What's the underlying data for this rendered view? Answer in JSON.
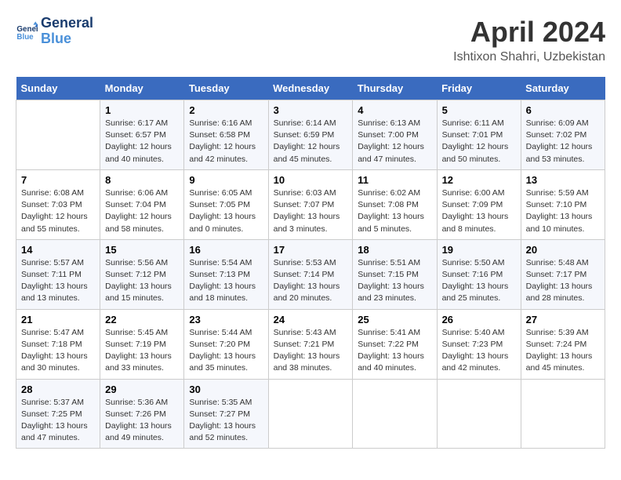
{
  "header": {
    "logo_line1": "General",
    "logo_line2": "Blue",
    "title": "April 2024",
    "subtitle": "Ishtixon Shahri, Uzbekistan"
  },
  "calendar": {
    "days_of_week": [
      "Sunday",
      "Monday",
      "Tuesday",
      "Wednesday",
      "Thursday",
      "Friday",
      "Saturday"
    ],
    "weeks": [
      [
        {
          "day": "",
          "info": ""
        },
        {
          "day": "1",
          "info": "Sunrise: 6:17 AM\nSunset: 6:57 PM\nDaylight: 12 hours\nand 40 minutes."
        },
        {
          "day": "2",
          "info": "Sunrise: 6:16 AM\nSunset: 6:58 PM\nDaylight: 12 hours\nand 42 minutes."
        },
        {
          "day": "3",
          "info": "Sunrise: 6:14 AM\nSunset: 6:59 PM\nDaylight: 12 hours\nand 45 minutes."
        },
        {
          "day": "4",
          "info": "Sunrise: 6:13 AM\nSunset: 7:00 PM\nDaylight: 12 hours\nand 47 minutes."
        },
        {
          "day": "5",
          "info": "Sunrise: 6:11 AM\nSunset: 7:01 PM\nDaylight: 12 hours\nand 50 minutes."
        },
        {
          "day": "6",
          "info": "Sunrise: 6:09 AM\nSunset: 7:02 PM\nDaylight: 12 hours\nand 53 minutes."
        }
      ],
      [
        {
          "day": "7",
          "info": "Sunrise: 6:08 AM\nSunset: 7:03 PM\nDaylight: 12 hours\nand 55 minutes."
        },
        {
          "day": "8",
          "info": "Sunrise: 6:06 AM\nSunset: 7:04 PM\nDaylight: 12 hours\nand 58 minutes."
        },
        {
          "day": "9",
          "info": "Sunrise: 6:05 AM\nSunset: 7:05 PM\nDaylight: 13 hours\nand 0 minutes."
        },
        {
          "day": "10",
          "info": "Sunrise: 6:03 AM\nSunset: 7:07 PM\nDaylight: 13 hours\nand 3 minutes."
        },
        {
          "day": "11",
          "info": "Sunrise: 6:02 AM\nSunset: 7:08 PM\nDaylight: 13 hours\nand 5 minutes."
        },
        {
          "day": "12",
          "info": "Sunrise: 6:00 AM\nSunset: 7:09 PM\nDaylight: 13 hours\nand 8 minutes."
        },
        {
          "day": "13",
          "info": "Sunrise: 5:59 AM\nSunset: 7:10 PM\nDaylight: 13 hours\nand 10 minutes."
        }
      ],
      [
        {
          "day": "14",
          "info": "Sunrise: 5:57 AM\nSunset: 7:11 PM\nDaylight: 13 hours\nand 13 minutes."
        },
        {
          "day": "15",
          "info": "Sunrise: 5:56 AM\nSunset: 7:12 PM\nDaylight: 13 hours\nand 15 minutes."
        },
        {
          "day": "16",
          "info": "Sunrise: 5:54 AM\nSunset: 7:13 PM\nDaylight: 13 hours\nand 18 minutes."
        },
        {
          "day": "17",
          "info": "Sunrise: 5:53 AM\nSunset: 7:14 PM\nDaylight: 13 hours\nand 20 minutes."
        },
        {
          "day": "18",
          "info": "Sunrise: 5:51 AM\nSunset: 7:15 PM\nDaylight: 13 hours\nand 23 minutes."
        },
        {
          "day": "19",
          "info": "Sunrise: 5:50 AM\nSunset: 7:16 PM\nDaylight: 13 hours\nand 25 minutes."
        },
        {
          "day": "20",
          "info": "Sunrise: 5:48 AM\nSunset: 7:17 PM\nDaylight: 13 hours\nand 28 minutes."
        }
      ],
      [
        {
          "day": "21",
          "info": "Sunrise: 5:47 AM\nSunset: 7:18 PM\nDaylight: 13 hours\nand 30 minutes."
        },
        {
          "day": "22",
          "info": "Sunrise: 5:45 AM\nSunset: 7:19 PM\nDaylight: 13 hours\nand 33 minutes."
        },
        {
          "day": "23",
          "info": "Sunrise: 5:44 AM\nSunset: 7:20 PM\nDaylight: 13 hours\nand 35 minutes."
        },
        {
          "day": "24",
          "info": "Sunrise: 5:43 AM\nSunset: 7:21 PM\nDaylight: 13 hours\nand 38 minutes."
        },
        {
          "day": "25",
          "info": "Sunrise: 5:41 AM\nSunset: 7:22 PM\nDaylight: 13 hours\nand 40 minutes."
        },
        {
          "day": "26",
          "info": "Sunrise: 5:40 AM\nSunset: 7:23 PM\nDaylight: 13 hours\nand 42 minutes."
        },
        {
          "day": "27",
          "info": "Sunrise: 5:39 AM\nSunset: 7:24 PM\nDaylight: 13 hours\nand 45 minutes."
        }
      ],
      [
        {
          "day": "28",
          "info": "Sunrise: 5:37 AM\nSunset: 7:25 PM\nDaylight: 13 hours\nand 47 minutes."
        },
        {
          "day": "29",
          "info": "Sunrise: 5:36 AM\nSunset: 7:26 PM\nDaylight: 13 hours\nand 49 minutes."
        },
        {
          "day": "30",
          "info": "Sunrise: 5:35 AM\nSunset: 7:27 PM\nDaylight: 13 hours\nand 52 minutes."
        },
        {
          "day": "",
          "info": ""
        },
        {
          "day": "",
          "info": ""
        },
        {
          "day": "",
          "info": ""
        },
        {
          "day": "",
          "info": ""
        }
      ]
    ]
  }
}
